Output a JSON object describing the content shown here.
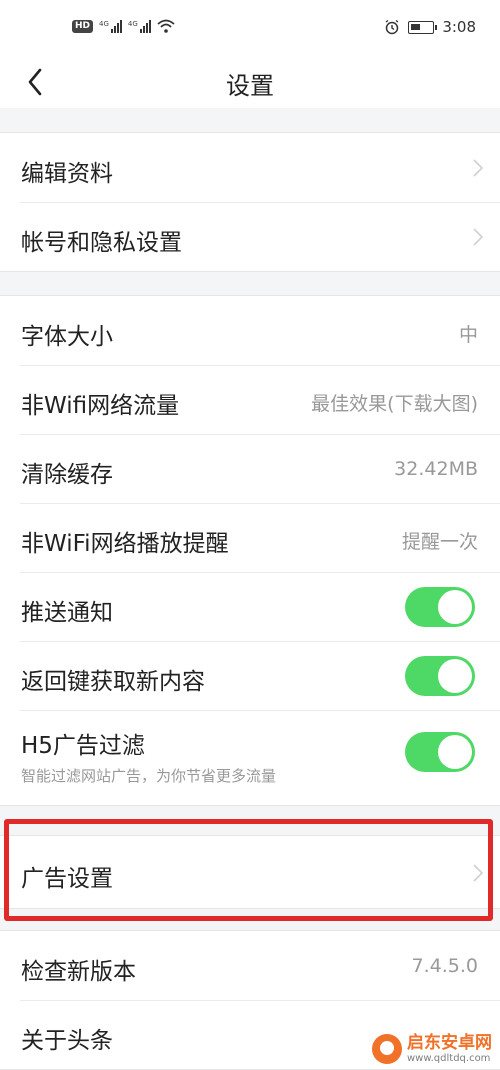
{
  "status_bar": {
    "hd_label": "HD",
    "net1_label": "4G",
    "net2_label": "4G",
    "time": "3:08"
  },
  "header": {
    "title": "设置"
  },
  "profile_group": [
    {
      "label": "编辑资料"
    },
    {
      "label": "帐号和隐私设置"
    }
  ],
  "settings_group": [
    {
      "label": "字体大小",
      "value": "中"
    },
    {
      "label": "非Wifi网络流量",
      "value": "最佳效果(下载大图)"
    },
    {
      "label": "清除缓存",
      "value": "32.42MB"
    },
    {
      "label": "非WiFi网络播放提醒",
      "value": "提醒一次"
    },
    {
      "label": "推送通知",
      "toggle_on": true
    },
    {
      "label": "返回键获取新内容",
      "toggle_on": true
    },
    {
      "label": "H5广告过滤",
      "sublabel": "智能过滤网站广告，为你节省更多流量",
      "toggle_on": true
    }
  ],
  "ad_group": {
    "label": "广告设置"
  },
  "about_group": [
    {
      "label": "检查新版本",
      "value": "7.4.5.0"
    },
    {
      "label": "关于头条"
    }
  ],
  "watermark": {
    "name": "启东安卓网",
    "url": "www.qdltdq.com"
  },
  "colors": {
    "toggle_on": "#4ed865",
    "highlight": "#e02a2a",
    "watermark": "#f06a1c"
  }
}
